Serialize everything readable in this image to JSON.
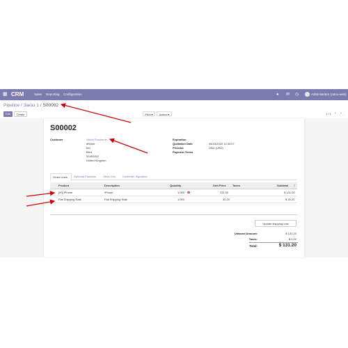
{
  "navbar": {
    "brand": "CRM",
    "menu": [
      "Sales",
      "Reporting",
      "Configuration"
    ],
    "user": "Administrator (odoo-web)"
  },
  "breadcrumb": {
    "parent": "Pipeline",
    "middle": "Заказ 1",
    "current": "S00002"
  },
  "control": {
    "edit": "Edit",
    "create": "Create",
    "print": "Print",
    "action": "Action",
    "pager": "1 / 1"
  },
  "order": {
    "name": "S00002",
    "customer_label": "Customer",
    "customer_name": "Valorii Frachenie",
    "customer_address": [
      "dt\\Morl",
      "fed",
      "Bled",
      "32452452",
      "United Kingdom"
    ],
    "expiration_label": "Expiration",
    "quotation_date_label": "Quotation Date",
    "quotation_date": "08/15/2020 14:33:07",
    "pricelist_label": "Pricelist",
    "pricelist": "USD (USD)",
    "payment_terms_label": "Payment Terms"
  },
  "tabs": [
    "Order Lines",
    "Optional Products",
    "Other Info",
    "Customer Signature"
  ],
  "lines": {
    "headers": [
      "Product",
      "Description",
      "Quantity",
      "Unit Price",
      "Taxes",
      "Subtotal"
    ],
    "rows": [
      {
        "product": "[00] iPhone",
        "description": "iPhone",
        "quantity": "1.000",
        "unit_price": "131.00",
        "taxes": "",
        "subtotal": "$ 131.00"
      },
      {
        "product": "Flat Shipping Rate",
        "description": "Flat Shipping Rate",
        "quantity": "1.000",
        "unit_price": "30.20",
        "taxes": "",
        "subtotal": "$ 30.20"
      }
    ]
  },
  "shipping_button": "Update shipping cost",
  "totals": {
    "untaxed_label": "Untaxed Amount:",
    "untaxed": "$ 131.20",
    "taxes_label": "Taxes:",
    "taxes": "$ 0.00",
    "total_label": "Total:",
    "total": "$ 131.20"
  },
  "colors": {
    "navbar": "#7c7bad",
    "arrow": "#cc0000"
  }
}
